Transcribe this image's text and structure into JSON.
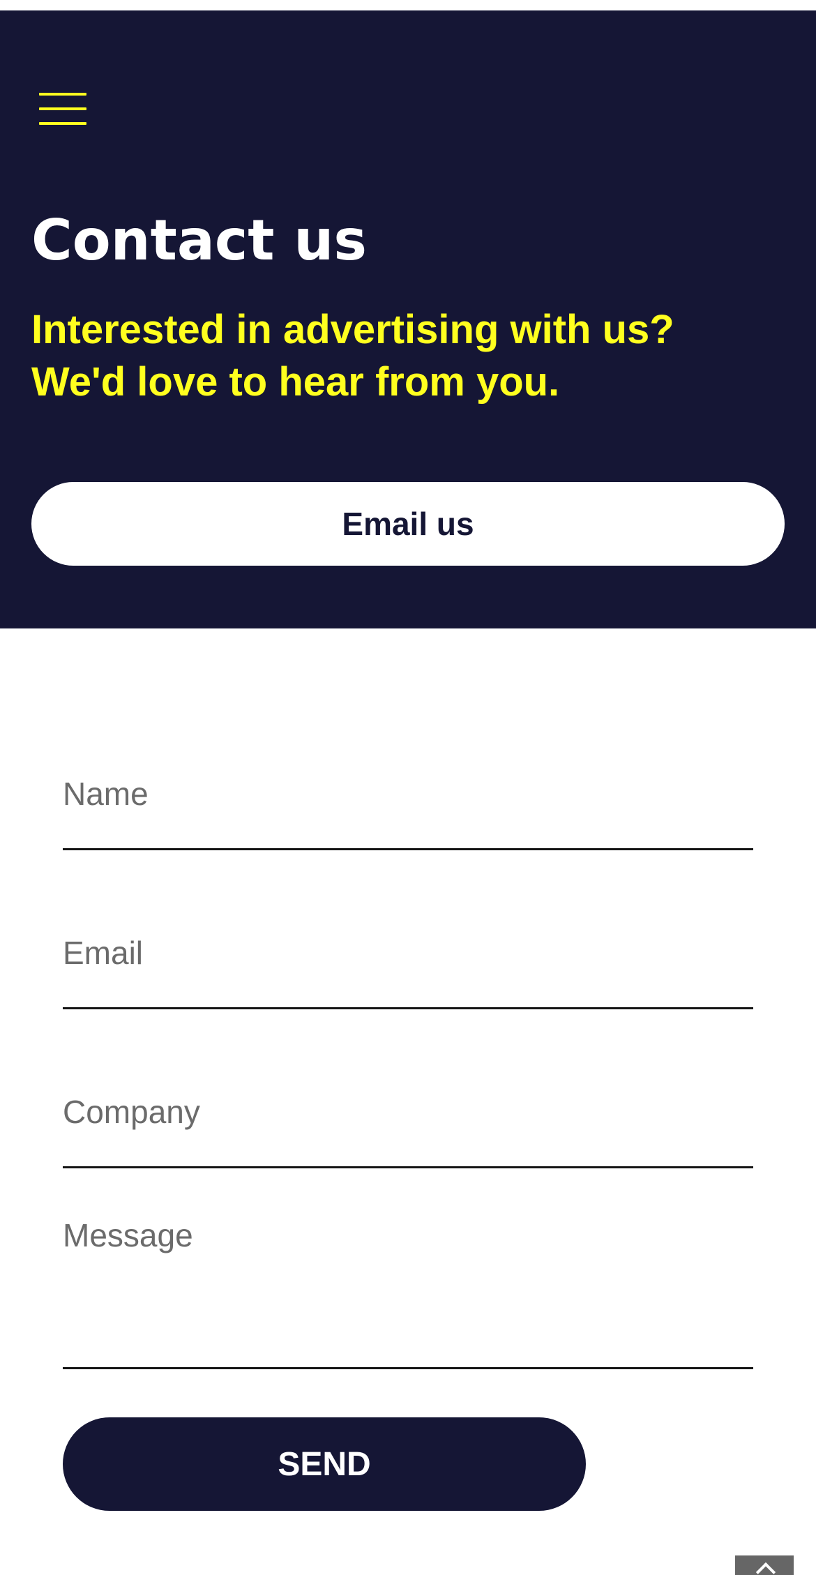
{
  "colors": {
    "hero_background": "#151635",
    "accent_yellow": "#ffff1f",
    "title_text": "#ffffff",
    "button_dark": "#151635",
    "placeholder_text": "#6b6b6b",
    "field_underline": "#151515"
  },
  "header": {
    "menu_icon": "hamburger-menu-icon"
  },
  "hero": {
    "title": "Contact us",
    "subtitle_line1": "Interested in advertising with us?",
    "subtitle_line2": "We'd love to hear from you.",
    "email_button_label": "Email us"
  },
  "form": {
    "name_placeholder": "Name",
    "email_placeholder": "Email",
    "company_placeholder": "Company",
    "message_placeholder": "Message",
    "name_value": "",
    "email_value": "",
    "company_value": "",
    "message_value": "",
    "send_label": "SEND"
  },
  "footer": {
    "scroll_top_icon": "chevron-up-icon"
  }
}
